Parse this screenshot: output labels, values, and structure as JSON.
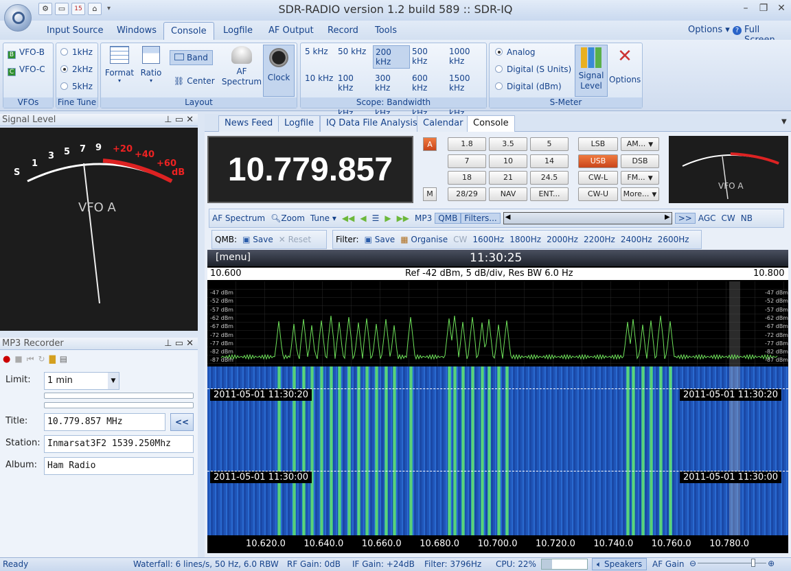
{
  "window": {
    "title": "SDR-RADIO version 1.2  build 589 :: SDR-IQ",
    "qat_icons": [
      "gear-icon",
      "window-icon",
      "calendar-icon",
      "home-icon"
    ],
    "qat_calendar_day": "15"
  },
  "menu": {
    "tabs": [
      "Input Source",
      "Windows",
      "Console",
      "Logfile",
      "AF Output",
      "Record",
      "Tools"
    ],
    "active": "Console",
    "options": "Options",
    "full_screen": "Full Screen"
  },
  "ribbon": {
    "vfos": {
      "label": "VFOs",
      "items": [
        {
          "badge": "B",
          "text": "VFO-B",
          "color": "#2f8f2f"
        },
        {
          "badge": "C",
          "text": "VFO-C",
          "color": "#2f8f2f"
        }
      ]
    },
    "fine_tune": {
      "label": "Fine Tune",
      "items": [
        "1kHz",
        "2kHz",
        "5kHz"
      ],
      "selected": "2kHz"
    },
    "layout": {
      "label": "Layout",
      "format": "Format",
      "ratio": "Ratio",
      "band": "Band",
      "center": "Center",
      "af_spectrum": "AF Spectrum",
      "clock": "Clock"
    },
    "bandwidth": {
      "label": "Scope: Bandwidth",
      "cells": [
        [
          "5 kHz",
          "50 kHz",
          "200 kHz",
          "500 kHz",
          "1000 kHz"
        ],
        [
          "10 kHz",
          "100 kHz",
          "300 kHz",
          "600 kHz",
          "1500 kHz"
        ],
        [
          "20 kHz",
          "150 kHz",
          "400 kHz",
          "800 kHz",
          "2000 kHz"
        ]
      ],
      "selected": "200 kHz"
    },
    "smeter": {
      "label": "S-Meter",
      "items": [
        "Analog",
        "Digital (S Units)",
        "Digital (dBm)"
      ],
      "selected": "Analog",
      "signal_level": "Signal Level",
      "options": "Options"
    }
  },
  "signal_panel": {
    "title": "Signal Level",
    "vfo": "VFO A",
    "scale_s": [
      "S",
      "1",
      "3",
      "5",
      "7",
      "9"
    ],
    "scale_db": [
      "+20",
      "+40",
      "+60",
      "dB"
    ]
  },
  "mp3": {
    "title": "MP3 Recorder",
    "limit_label": "Limit:",
    "limit_value": "1 min",
    "title_label": "Title:",
    "title_value": "10.779.857 MHz",
    "back_btn": "<<",
    "station_label": "Station:",
    "station_value": "Inmarsat3F2 1539.250Mhz",
    "album_label": "Album:",
    "album_value": "Ham Radio"
  },
  "doc_tabs": {
    "tabs": [
      "News Feed",
      "Logfile",
      "IQ Data File Analysis",
      "Calendar",
      "Console"
    ],
    "active": "Console"
  },
  "console": {
    "frequency": "10.779.857",
    "a_btn": "A",
    "m_btn": "M",
    "bands": [
      "1.8",
      "3.5",
      "5",
      "7",
      "10",
      "14",
      "18",
      "21",
      "24.5",
      "28/29",
      "NAV",
      "ENT..."
    ],
    "modes": [
      "LSB",
      "AM...",
      "USB",
      "DSB",
      "CW-L",
      "FM...",
      "CW-U",
      "More..."
    ],
    "active_mode": "USB",
    "mini_vfo": "VFO A"
  },
  "toolbar1": {
    "af_spectrum": "AF Spectrum",
    "zoom": "Zoom",
    "tune": "Tune",
    "mp3": "MP3",
    "qmb": "QMB",
    "filters": "Filters...",
    "more": ">>",
    "agc": "AGC",
    "cw": "CW",
    "nb": "NB"
  },
  "toolbar2": {
    "qmb": "QMB:",
    "save": "Save",
    "reset": "Reset",
    "filter": "Filter:",
    "save2": "Save",
    "organise": "Organise",
    "cw": "CW",
    "filters": [
      "1600Hz",
      "1800Hz",
      "2000Hz",
      "2200Hz",
      "2400Hz",
      "2600Hz"
    ]
  },
  "spectrum": {
    "menu": "[menu]",
    "clock": "11:30:25",
    "left_freq": "10.600",
    "right_freq": "10.800",
    "info": "Ref -42 dBm,  5 dB/div,  Res BW 6.0 Hz",
    "dbm": [
      "-47 dBm",
      "-52 dBm",
      "-57 dBm",
      "-62 dBm",
      "-67 dBm",
      "-72 dBm",
      "-77 dBm",
      "-82 dBm",
      "-87 dBm"
    ],
    "stamp1": "2011-05-01  11:30:20",
    "stamp2": "2011-05-01  11:30:00",
    "x_ticks": [
      "10.620.0",
      "10.640.0",
      "10.660.0",
      "10.680.0",
      "10.700.0",
      "10.720.0",
      "10.740.0",
      "10.760.0",
      "10.780.0"
    ]
  },
  "status": {
    "ready": "Ready",
    "waterfall": "Waterfall: 6 lines/s, 50 Hz, 6.0 RBW",
    "rf": "RF Gain: 0dB",
    "if": "IF Gain: +24dB",
    "filter": "Filter: 3796Hz",
    "cpu": "CPU: 22%",
    "speakers": "Speakers",
    "af_gain": "AF Gain"
  }
}
